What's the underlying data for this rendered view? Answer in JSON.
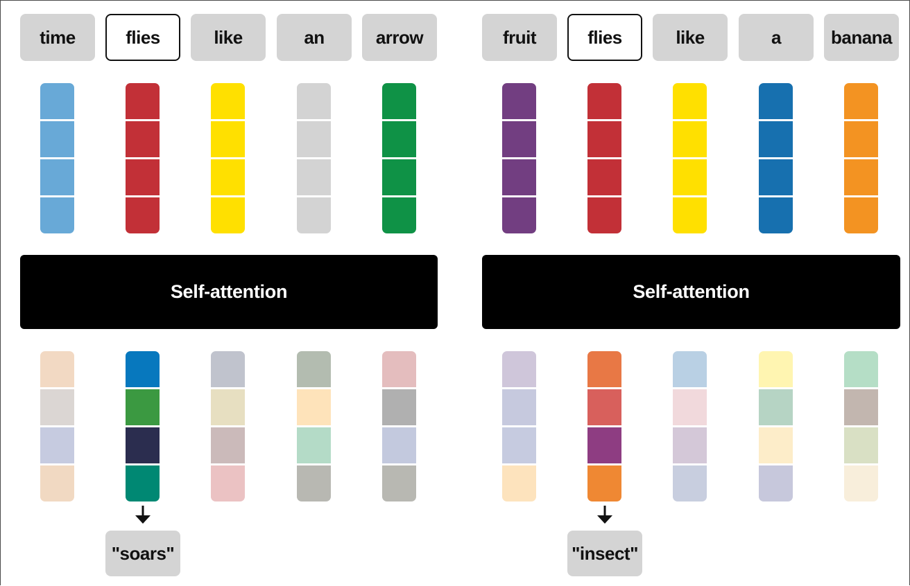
{
  "left": {
    "tokens": [
      "time",
      "flies",
      "like",
      "an",
      "arrow"
    ],
    "highlight_index": 1,
    "attention_label": "Self-attention",
    "output_label": "\"soars\"",
    "embeddings": [
      [
        "#68a9d7",
        "#68a9d7",
        "#68a9d7",
        "#68a9d7"
      ],
      [
        "#c23037",
        "#c23037",
        "#c23037",
        "#c23037"
      ],
      [
        "#ffe000",
        "#ffe000",
        "#ffe000",
        "#ffe000"
      ],
      [
        "#d3d3d3",
        "#d3d3d3",
        "#d3d3d3",
        "#d3d3d3"
      ],
      [
        "#0f9246",
        "#0f9246",
        "#0f9246",
        "#0f9246"
      ]
    ],
    "contextual": [
      [
        "#f2d9c3",
        "#dbd6d3",
        "#c6cbe0",
        "#f1d9c2"
      ],
      [
        "#0778be",
        "#3b9941",
        "#2b2d4f",
        "#008873"
      ],
      [
        "#c0c3cd",
        "#e7dfc1",
        "#cbbaba",
        "#ebc2c3"
      ],
      [
        "#b3bcb0",
        "#fee3ba",
        "#b4dbc7",
        "#b8b8b2"
      ],
      [
        "#e4bdbe",
        "#b0b0b0",
        "#c3c9de",
        "#b8b8b2"
      ]
    ]
  },
  "right": {
    "tokens": [
      "fruit",
      "flies",
      "like",
      "a",
      "banana"
    ],
    "highlight_index": 1,
    "attention_label": "Self-attention",
    "output_label": "\"insect\"",
    "embeddings": [
      [
        "#723e81",
        "#723e81",
        "#723e81",
        "#723e81"
      ],
      [
        "#c23037",
        "#c23037",
        "#c23037",
        "#c23037"
      ],
      [
        "#ffe000",
        "#ffe000",
        "#ffe000",
        "#ffe000"
      ],
      [
        "#1770af",
        "#1770af",
        "#1770af",
        "#1770af"
      ],
      [
        "#f39322",
        "#f39322",
        "#f39322",
        "#f39322"
      ]
    ],
    "contextual": [
      [
        "#cfc6da",
        "#c6c9de",
        "#c6cbe0",
        "#fde3bd"
      ],
      [
        "#e87845",
        "#d8605c",
        "#8e3d82",
        "#ef8833"
      ],
      [
        "#b9d0e4",
        "#f1d9dc",
        "#d4c8d8",
        "#c8cedf"
      ],
      [
        "#fff5b1",
        "#b6d4c4",
        "#fdedc9",
        "#c7c8dc"
      ],
      [
        "#b5dec6",
        "#c2b6af",
        "#d9e0c4",
        "#f8eedb"
      ]
    ]
  }
}
